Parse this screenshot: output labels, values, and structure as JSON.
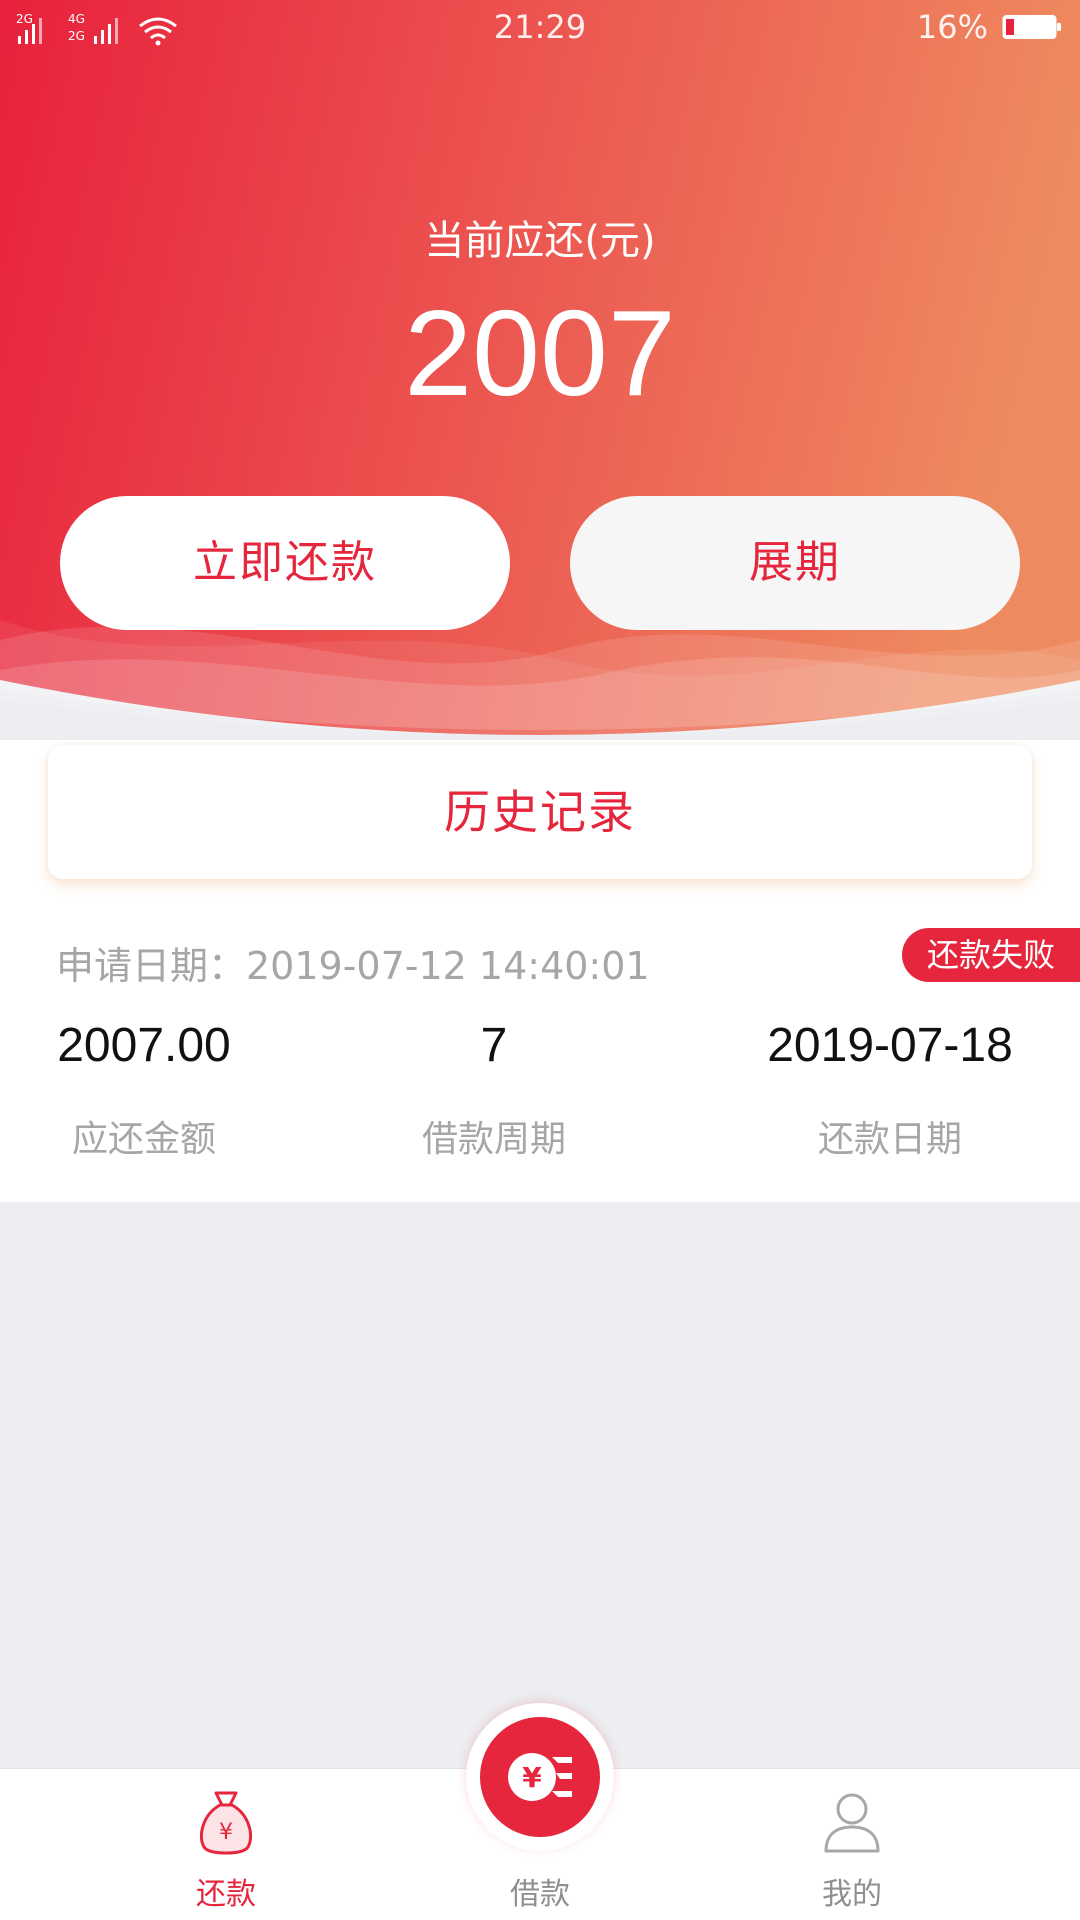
{
  "status_bar": {
    "time": "21:29",
    "battery": "16%",
    "signal1": "2G",
    "signal2a": "4G",
    "signal2b": "2G"
  },
  "header": {
    "amount_label": "当前应还(元)",
    "amount": "2007",
    "pay_button": "立即还款",
    "extend_button": "展期"
  },
  "history": {
    "title": "历史记录"
  },
  "record": {
    "apply_date": "申请日期：2019-07-12 14:40:01",
    "status": "还款失败",
    "amount_value": "2007.00",
    "amount_label": "应还金额",
    "period_value": "7",
    "period_label": "借款周期",
    "due_value": "2019-07-18",
    "due_label": "还款日期"
  },
  "nav": {
    "repay": "还款",
    "loan": "借款",
    "mine": "我的"
  },
  "colors": {
    "accent": "#E6263D",
    "gradient_start": "#E8213C",
    "gradient_end": "#EE8A5F"
  },
  "icons": {
    "repay": "money-bag-icon",
    "loan": "yen-coin-icon",
    "mine": "user-icon"
  }
}
